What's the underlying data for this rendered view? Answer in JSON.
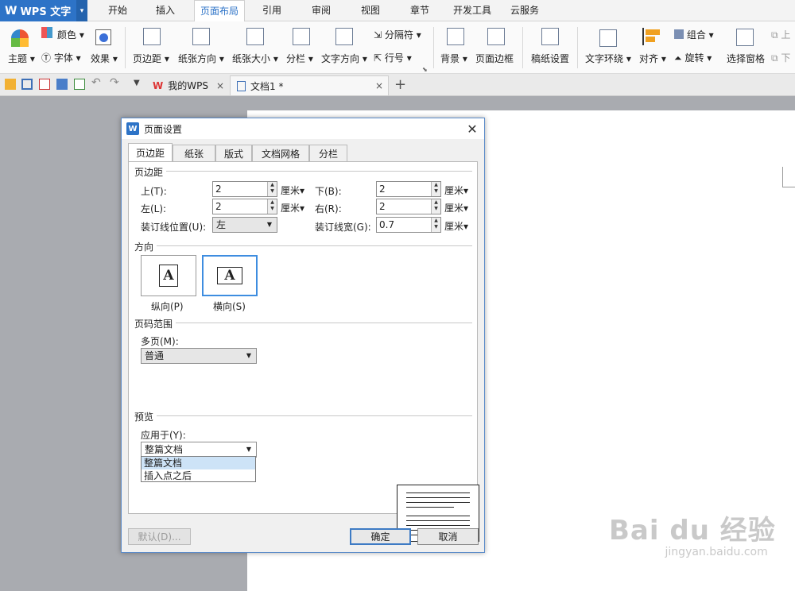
{
  "app": {
    "title": "WPS 文字",
    "tabs": [
      "开始",
      "插入",
      "页面布局",
      "引用",
      "审阅",
      "视图",
      "章节",
      "开发工具",
      "云服务"
    ],
    "active_tab": "页面布局"
  },
  "ribbon": {
    "color": "颜色",
    "theme": "主题",
    "font": "字体",
    "effect": "效果",
    "margins": "页边距",
    "orientation": "纸张方向",
    "size": "纸张大小",
    "columns": "分栏",
    "text_direction": "文字方向",
    "separator": "分隔符",
    "line_numbers": "行号",
    "background": "背景",
    "page_border": "页面边框",
    "manuscript": "稿纸设置",
    "wrap": "文字环绕",
    "align": "对齐",
    "group": "组合",
    "rotate": "旋转",
    "selection_pane": "选择窗格",
    "up": "上",
    "down": "下"
  },
  "doc_tabs": [
    {
      "label": "我的WPS",
      "close": "×"
    },
    {
      "label": "文档1 *",
      "close": "×"
    }
  ],
  "new_tab": "+",
  "dialog": {
    "title": "页面设置",
    "close": "✕",
    "tabs": [
      "页边距",
      "纸张",
      "版式",
      "文档网格",
      "分栏"
    ],
    "active_tab": "页边距",
    "margins_group": "页边距",
    "top_label": "上(T):",
    "top_value": "2",
    "bottom_label": "下(B):",
    "bottom_value": "2",
    "left_label": "左(L):",
    "left_value": "2",
    "right_label": "右(R):",
    "right_value": "2",
    "gutter_pos_label": "装订线位置(U):",
    "gutter_pos_value": "左",
    "gutter_width_label": "装订线宽(G):",
    "gutter_width_value": "0.7",
    "unit": "厘米",
    "orientation_group": "方向",
    "portrait": "纵向(P)",
    "landscape": "横向(S)",
    "orientation_glyph": "A",
    "page_range_group": "页码范围",
    "multi_page_label": "多页(M):",
    "multi_page_value": "普通",
    "preview_group": "预览",
    "apply_to_label": "应用于(Y):",
    "apply_to_value": "整篇文档",
    "apply_to_options": [
      "整篇文档",
      "插入点之后"
    ],
    "default_btn": "默认(D)...",
    "ok_btn": "确定",
    "cancel_btn": "取消"
  },
  "watermark": {
    "logo": "Bai du 经验",
    "url": "jingyan.baidu.com"
  }
}
